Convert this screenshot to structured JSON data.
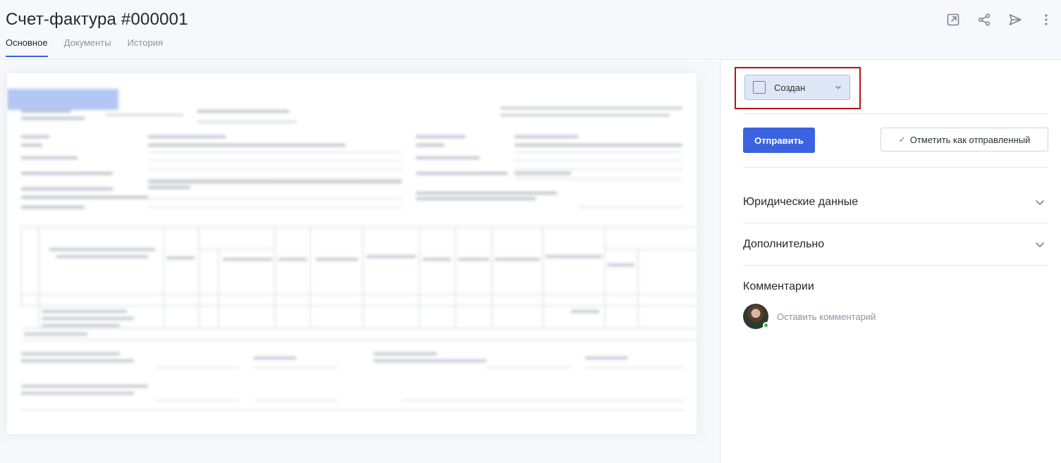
{
  "header": {
    "title": "Счет-фактура #000001",
    "tabs": [
      {
        "label": "Основное",
        "active": true
      },
      {
        "label": "Документы",
        "active": false
      },
      {
        "label": "История",
        "active": false
      }
    ],
    "actions": [
      "external-link-icon",
      "share-icon",
      "send-icon",
      "more-vertical-icon"
    ]
  },
  "status": {
    "value": "Создан",
    "checked": false
  },
  "actions": {
    "send_label": "Отправить",
    "mark_sent_label": "Отметить как отправленный"
  },
  "sections": [
    {
      "title": "Юридические данные",
      "expanded": false
    },
    {
      "title": "Дополнительно",
      "expanded": false
    }
  ],
  "comments": {
    "title": "Комментарии",
    "placeholder": "Оставить комментарий"
  },
  "colors": {
    "accent": "#3b63e0",
    "highlight_frame": "#b4141b",
    "status_bg": "#dfe7f6",
    "online": "#2fbf5a"
  }
}
